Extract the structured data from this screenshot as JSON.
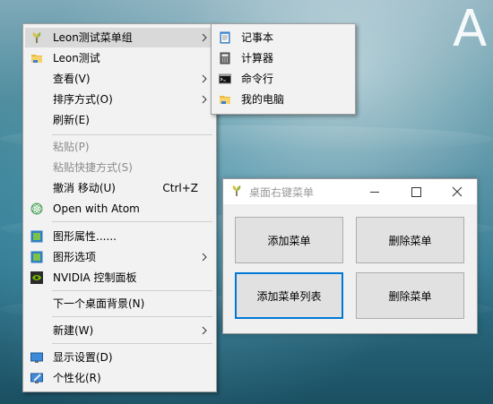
{
  "desktop": {
    "partial_text": "A"
  },
  "context_menu": {
    "items": [
      {
        "label": "Leon测试菜单组",
        "icon": "leon-app-icon",
        "submenu": true,
        "highlighted": true
      },
      {
        "label": "Leon测试",
        "icon": "folder-icon"
      },
      {
        "label": "查看(V)",
        "submenu": true
      },
      {
        "label": "排序方式(O)",
        "submenu": true
      },
      {
        "label": "刷新(E)"
      },
      {
        "label": "粘贴(P)",
        "disabled": true
      },
      {
        "label": "粘贴快捷方式(S)",
        "disabled": true
      },
      {
        "label": "撤消 移动(U)",
        "shortcut": "Ctrl+Z"
      },
      {
        "label": "Open with Atom",
        "icon": "atom-icon"
      },
      {
        "label": "图形属性......",
        "icon": "intel-graphics-icon"
      },
      {
        "label": "图形选项",
        "icon": "intel-graphics-icon",
        "submenu": true
      },
      {
        "label": "NVIDIA 控制面板",
        "icon": "nvidia-icon"
      },
      {
        "label": "下一个桌面背景(N)"
      },
      {
        "label": "新建(W)",
        "submenu": true
      },
      {
        "label": "显示设置(D)",
        "icon": "display-icon"
      },
      {
        "label": "个性化(R)",
        "icon": "personalize-icon"
      }
    ]
  },
  "submenu": {
    "items": [
      {
        "label": "记事本",
        "icon": "notepad-icon"
      },
      {
        "label": "计算器",
        "icon": "calculator-icon"
      },
      {
        "label": "命令行",
        "icon": "cmd-icon"
      },
      {
        "label": "我的电脑",
        "icon": "folder-icon"
      }
    ]
  },
  "window": {
    "title": "桌面右键菜单",
    "buttons": [
      {
        "label": "添加菜单"
      },
      {
        "label": "删除菜单"
      },
      {
        "label": "添加菜单列表",
        "focused": true
      },
      {
        "label": "删除菜单"
      }
    ]
  },
  "colors": {
    "focus": "#0078d7",
    "menu_bg": "#f2f2f2",
    "highlight": "#d9d9d9"
  }
}
